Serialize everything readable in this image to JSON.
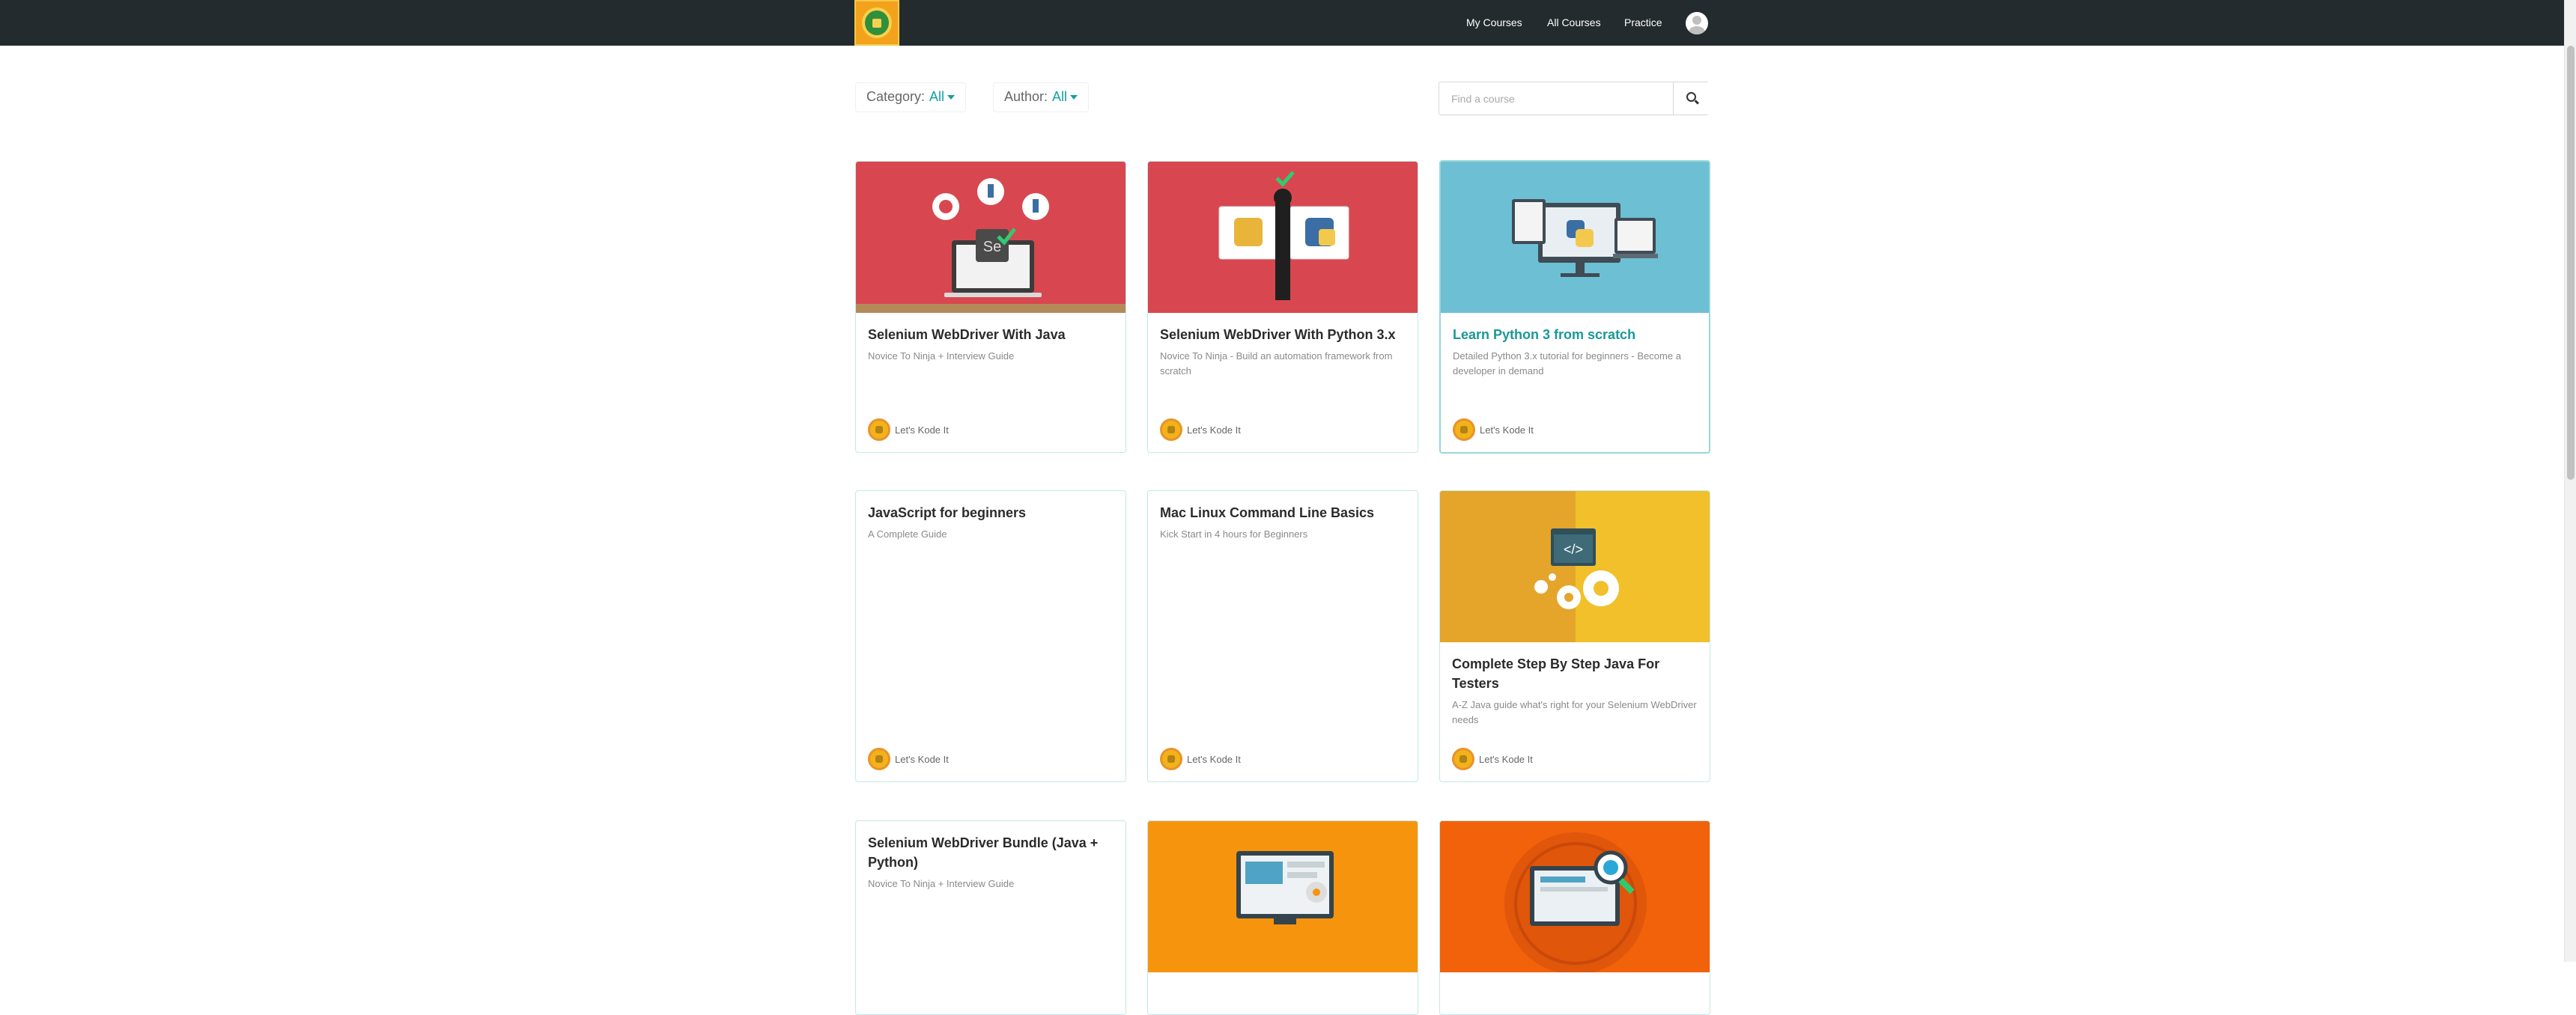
{
  "nav": {
    "links": [
      "My Courses",
      "All Courses",
      "Practice"
    ]
  },
  "filters": {
    "category_label": "Category:",
    "category_value": "All",
    "author_label": "Author:",
    "author_value": "All"
  },
  "search": {
    "placeholder": "Find a course",
    "icon": "search-icon"
  },
  "colors": {
    "topbar": "#242b2e",
    "accent": "#11a0a0"
  },
  "courses": [
    {
      "title": "Selenium WebDriver With Java",
      "subtitle": "Novice To Ninja + Interview Guide",
      "author": "Let's Kode It"
    },
    {
      "title": "Selenium WebDriver With Python 3.x",
      "subtitle": "Novice To Ninja - Build an automation framework from scratch",
      "author": "Let's Kode It"
    },
    {
      "title": "Learn Python 3 from scratch",
      "subtitle": "Detailed Python 3.x tutorial for beginners - Become a developer in demand",
      "author": "Let's Kode It"
    },
    {
      "title": "JavaScript for beginners",
      "subtitle": "A Complete Guide",
      "author": "Let's Kode It"
    },
    {
      "title": "Mac Linux Command Line Basics",
      "subtitle": "Kick Start in 4 hours for Beginners",
      "author": "Let's Kode It"
    },
    {
      "title": "Complete Step By Step Java For Testers",
      "subtitle": "A-Z Java guide what's right for your Selenium WebDriver needs",
      "author": "Let's Kode It"
    },
    {
      "title": "Selenium WebDriver Bundle (Java + Python)",
      "subtitle": "Novice To Ninja + Interview Guide",
      "author": ""
    },
    {
      "title": "",
      "subtitle": "",
      "author": ""
    },
    {
      "title": "",
      "subtitle": "",
      "author": ""
    }
  ]
}
